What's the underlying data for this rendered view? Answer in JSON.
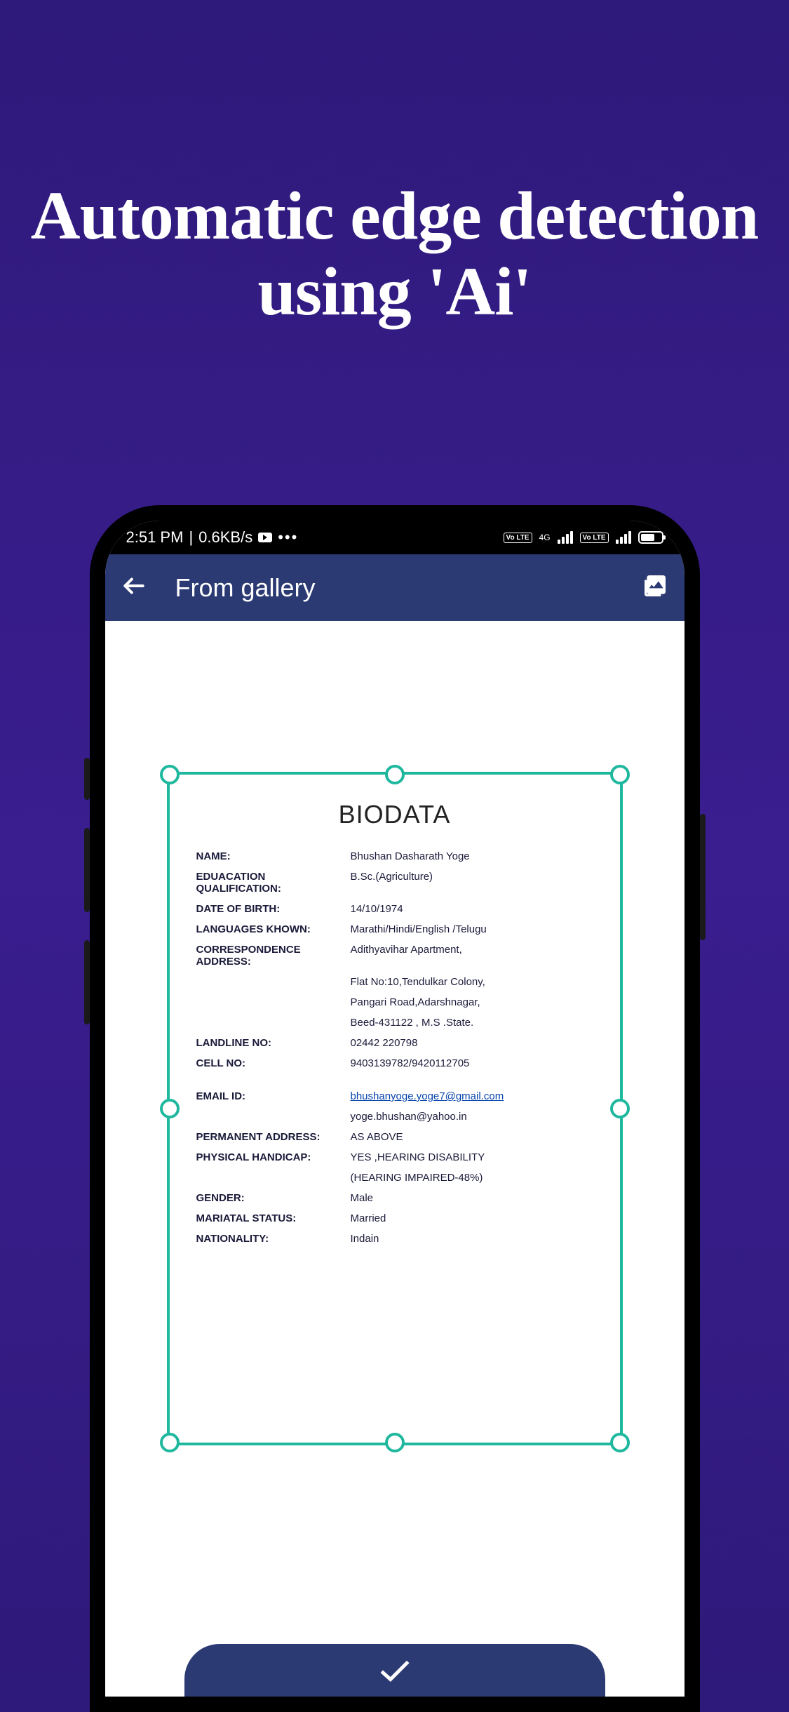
{
  "promo": {
    "headline": "Automatic edge detection using 'Ai'"
  },
  "statusBar": {
    "time": "2:51 PM",
    "network": "0.6KB/s",
    "lte1": "Vo LTE",
    "lte2": "Vo LTE",
    "signal4g": "4G"
  },
  "appBar": {
    "title": "From gallery"
  },
  "document": {
    "title": "BIODATA",
    "fields": {
      "name_label": "NAME:",
      "name_value": "Bhushan Dasharath Yoge",
      "edu_label": "EDUACATION QUALIFICATION:",
      "edu_value": "B.Sc.(Agriculture)",
      "dob_label": "DATE OF BIRTH:",
      "dob_value": "14/10/1974",
      "lang_label": "LANGUAGES KHOWN:",
      "lang_value": "Marathi/Hindi/English /Telugu",
      "addr_label": "CORRESPONDENCE ADDRESS:",
      "addr_line1": "Adithyavihar Apartment,",
      "addr_line2": "Flat No:10,Tendulkar Colony,",
      "addr_line3": "Pangari Road,Adarshnagar,",
      "addr_line4": "Beed-431122 ,   M.S .State.",
      "landline_label": "LANDLINE NO:",
      "landline_value": "02442 220798",
      "cell_label": "CELL NO:",
      "cell_value": "9403139782/9420112705",
      "email_label": "EMAIL ID:",
      "email_value1": "bhushanyoge.yoge7@gmail.com",
      "email_value2": "yoge.bhushan@yahoo.in",
      "perm_label": "PERMANENT ADDRESS:",
      "perm_value": "AS ABOVE",
      "handicap_label": "PHYSICAL HANDICAP:",
      "handicap_value1": "YES ,HEARING  DISABILITY",
      "handicap_value2": "(HEARING     IMPAIRED-48%)",
      "gender_label": "GENDER:",
      "gender_value": "Male",
      "marital_label": "MARIATAL STATUS:",
      "marital_value": "Married",
      "nationality_label": "NATIONALITY:",
      "nationality_value": "Indain"
    }
  },
  "colors": {
    "accent": "#1fb89e",
    "appbar": "#2c3a73"
  }
}
